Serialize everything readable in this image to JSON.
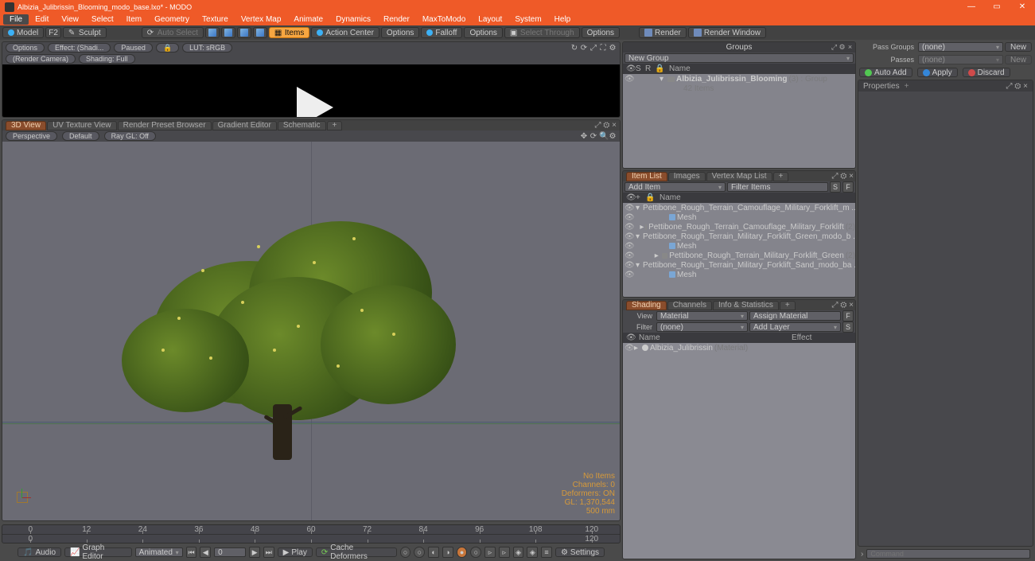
{
  "title": "Albizia_Julibrissin_Blooming_modo_base.lxo* - MODO",
  "menu": [
    "File",
    "Edit",
    "View",
    "Select",
    "Item",
    "Geometry",
    "Texture",
    "Vertex Map",
    "Animate",
    "Dynamics",
    "Render",
    "MaxToModo",
    "Layout",
    "System",
    "Help"
  ],
  "tb": {
    "model": "Model",
    "f2": "F2",
    "sculpt": "Sculpt",
    "autosel": "Auto Select",
    "items": "Items",
    "ac": "Action Center",
    "opt": "Options",
    "fall": "Falloff",
    "selthru": "Select Through",
    "render": "Render",
    "rwin": "Render Window"
  },
  "prev": {
    "opt": "Options",
    "effect": "Effect: (Shadi...",
    "paused": "Paused",
    "lut": "LUT: sRGB",
    "cam": "(Render Camera)",
    "shade": "Shading: Full"
  },
  "vp": {
    "tabs": [
      "3D View",
      "UV Texture View",
      "Render Preset Browser",
      "Gradient Editor",
      "Schematic"
    ],
    "persp": "Perspective",
    "default": "Default",
    "raygl": "Ray GL: Off",
    "stats": {
      "a": "No Items",
      "b": "Channels: 0",
      "c": "Deformers: ON",
      "d": "GL: 1,370,544",
      "e": "500 mm"
    }
  },
  "timeline": {
    "ticks": [
      "0",
      "12",
      "24",
      "36",
      "48",
      "60",
      "72",
      "84",
      "96",
      "108",
      "120"
    ],
    "tick0": "0",
    "tick120": "120"
  },
  "bb": {
    "audio": "Audio",
    "ge": "Graph Editor",
    "anim": "Animated",
    "frame": "0",
    "play": "Play",
    "cd": "Cache Deformers",
    "set": "Settings"
  },
  "groups": {
    "title": "Groups",
    "newgroup": "New Group",
    "nameh": "Name",
    "item": "Albizia_Julibrissin_Blooming",
    "itemSuffix": "(3) : Group",
    "sub": "42 Items"
  },
  "itemlist": {
    "tabs": [
      "Item List",
      "Images",
      "Vertex Map List"
    ],
    "add": "Add Item",
    "filter": "Filter Items",
    "nameh": "Name",
    "rows": [
      {
        "indent": 0,
        "arr": "▾",
        "name": "Pettibone_Rough_Terrain_Camouflage_Military_Forklift_m ..."
      },
      {
        "indent": 1,
        "mesh": true,
        "name": "Mesh"
      },
      {
        "indent": 0,
        "arr": "▸",
        "name": "Pettibone_Rough_Terrain_Camouflage_Military_Forklift",
        "suffix": "(2)"
      },
      {
        "indent": 0,
        "arr": "▾",
        "name": "Pettibone_Rough_Terrain_Military_Forklift_Green_modo_b ..."
      },
      {
        "indent": 1,
        "mesh": true,
        "name": "Mesh"
      },
      {
        "indent": 0,
        "arr": "▸",
        "name": "Pettibone_Rough_Terrain_Military_Forklift_Green",
        "suffix": "(2)"
      },
      {
        "indent": 0,
        "arr": "▾",
        "name": "Pettibone_Rough_Terrain_Military_Forklift_Sand_modo_ba ..."
      },
      {
        "indent": 1,
        "mesh": true,
        "name": "Mesh"
      }
    ]
  },
  "shading": {
    "tabs": [
      "Shading",
      "Channels",
      "Info & Statistics"
    ],
    "viewl": "View",
    "view": "Material",
    "assign": "Assign Material",
    "filterl": "Filter",
    "filter": "(none)",
    "addlayer": "Add Layer",
    "nameh": "Name",
    "effh": "Effect",
    "row": {
      "name": "Albizia_Julibrissin",
      "suffix": "(Material)"
    }
  },
  "right": {
    "passg": "Pass Groups",
    "passgv": "(none)",
    "new": "New",
    "passes": "Passes",
    "passesv": "(none)",
    "new2": "New",
    "aa": "Auto Add",
    "apply": "Apply",
    "discard": "Discard",
    "props": "Properties",
    "cmd": "Command"
  }
}
